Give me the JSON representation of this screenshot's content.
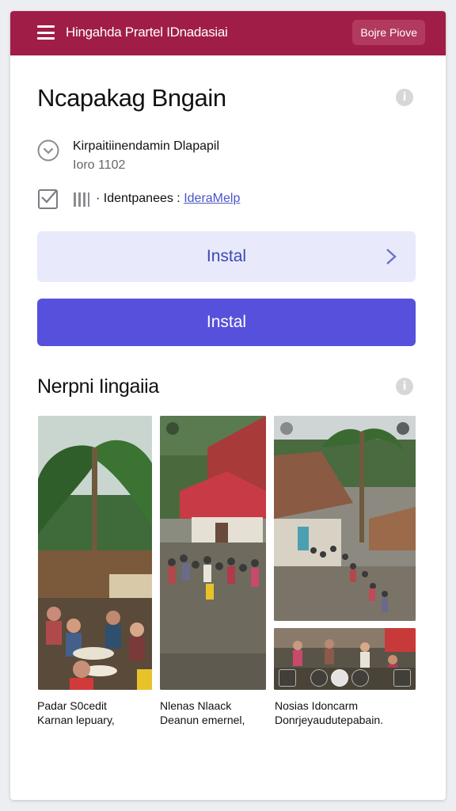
{
  "header": {
    "menu_icon": "hamburger-icon",
    "title": "Hingahda Prartel IDnadasiai",
    "action_label": "Bojre Piove"
  },
  "details": {
    "title": "Ncapakag Bngain",
    "primary": "Kirpaitiinendamin Dlapapil",
    "secondary": "Ioro 1102",
    "tag_prefix": "Identpanees",
    "tag_link": "IderaMelp",
    "icons": [
      "chevron-circle-icon",
      "checkbox-icon",
      "barcode-icon",
      "info-icon"
    ]
  },
  "actions": {
    "secondary_label": "Instal",
    "primary_label": "Instal"
  },
  "gallery": {
    "title": "Nerpni Iingaiia",
    "items": [
      {
        "line1": "Padar S0cedit",
        "line2": "Karnan lepuary,"
      },
      {
        "line1": "Nlenas Nlaack",
        "line2": "Deanun emernel,"
      },
      {
        "line1": "Nosias Idoncarm",
        "line2": "Donrjeyaudutepabain."
      }
    ]
  },
  "colors": {
    "brand": "#a01d48",
    "accent": "#5650dc",
    "accent_light": "#e8e9fb",
    "link": "#4a55c8"
  }
}
